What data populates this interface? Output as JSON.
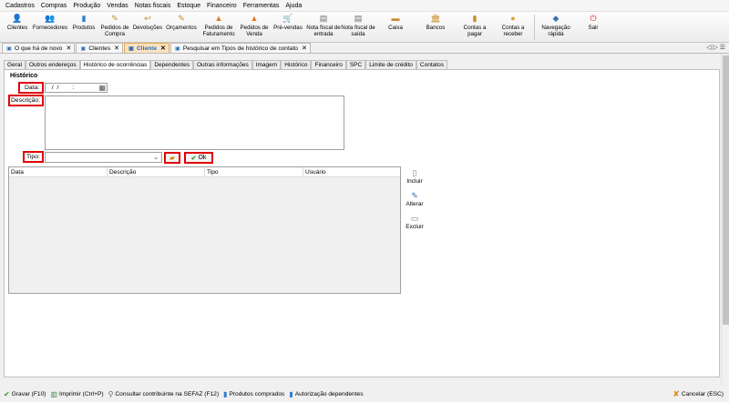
{
  "menu": [
    "Cadastros",
    "Compras",
    "Produção",
    "Vendas",
    "Notas fiscais",
    "Estoque",
    "Financeiro",
    "Ferramentas",
    "Ajuda"
  ],
  "toolbar": [
    {
      "label": "Clientes",
      "icon": "clients-icon"
    },
    {
      "label": "Fornecedores",
      "icon": "suppliers-icon"
    },
    {
      "label": "Produtos",
      "icon": "products-icon"
    },
    {
      "label": "Pedidos de Compra",
      "icon": "purchase-orders-icon"
    },
    {
      "label": "Devoluções",
      "icon": "returns-icon"
    },
    {
      "label": "Orçamentos",
      "icon": "quotes-icon"
    },
    {
      "label": "Pedidos de Faturamento",
      "icon": "billing-orders-icon"
    },
    {
      "label": "Pedidos de Venda",
      "icon": "sales-orders-icon"
    },
    {
      "label": "Pré-vendas",
      "icon": "pre-sales-icon"
    },
    {
      "label": "Nota fiscal de entrada",
      "icon": "inbound-invoice-icon"
    },
    {
      "label": "Nota fiscal de saída",
      "icon": "outbound-invoice-icon"
    },
    {
      "label": "Caixa",
      "icon": "cash-icon"
    },
    {
      "label": "Bancos",
      "icon": "banks-icon"
    },
    {
      "label": "Contas a pagar",
      "icon": "payables-icon"
    },
    {
      "label": "Contas a receber",
      "icon": "receivables-icon"
    },
    {
      "label": "Navegação rápida",
      "icon": "quick-nav-icon"
    },
    {
      "label": "Sair",
      "icon": "exit-icon"
    }
  ],
  "doc_tabs": [
    {
      "label": "O que há de novo",
      "active": false
    },
    {
      "label": "Clientes",
      "active": false
    },
    {
      "label": "Cliente",
      "active": true
    },
    {
      "label": "Pesquisar em Tipos de histórico de contato",
      "active": false
    }
  ],
  "nav_arrows": "◁ ▷ ☰",
  "sub_tabs": [
    {
      "label": "Geral",
      "active": false
    },
    {
      "label": "Outros endereços",
      "active": false
    },
    {
      "label": "Histórico de ocorrências",
      "active": true
    },
    {
      "label": "Dependentes",
      "active": false
    },
    {
      "label": "Outras informações",
      "active": false
    },
    {
      "label": "Imagem",
      "active": false
    },
    {
      "label": "Histórico",
      "active": false
    },
    {
      "label": "Financeiro",
      "active": false
    },
    {
      "label": "SPC",
      "active": false
    },
    {
      "label": "Limite de crédito",
      "active": false
    },
    {
      "label": "Contatos",
      "active": false
    }
  ],
  "form": {
    "section_title": "Histórico",
    "data_label": "Data:",
    "data_value": "  /  /        :",
    "descricao_label": "Descrição:",
    "descricao_value": "",
    "tipo_label": "Tipo:",
    "tipo_value": "",
    "ok_label": "Ok"
  },
  "grid": {
    "columns": [
      "Data",
      "Descrição",
      "Tipo",
      "Usuário"
    ],
    "rows": []
  },
  "side_actions": [
    {
      "label": "Incluir",
      "icon": "add-icon"
    },
    {
      "label": "Alterar",
      "icon": "edit-icon"
    },
    {
      "label": "Excluir",
      "icon": "delete-icon"
    }
  ],
  "status_bar": [
    {
      "label": "Gravar (F10)",
      "icon": "check-icon"
    },
    {
      "label": "Imprimir (Ctrl+P)",
      "icon": "print-icon"
    },
    {
      "label": "Consultar contribuinte na SEFAZ (F12)",
      "icon": "search-taxpayer-icon"
    },
    {
      "label": "Produtos comprados",
      "icon": "products-bought-icon"
    },
    {
      "label": "Autorização dependentes",
      "icon": "dependents-auth-icon"
    }
  ],
  "cancel_label": "Cancelar (ESC)"
}
